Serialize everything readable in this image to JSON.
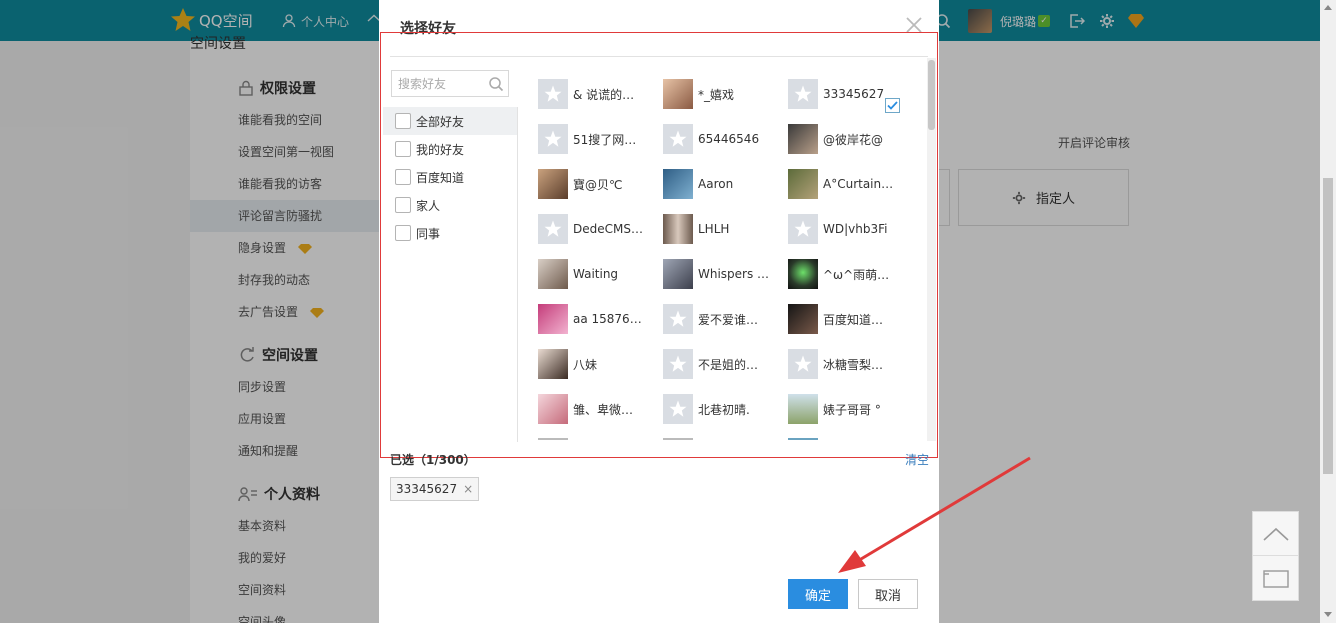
{
  "topbar": {
    "logo": "QQ空间",
    "nav_personal": "个人中心",
    "user_name": "倪璐璐"
  },
  "page": {
    "title": "空间设置",
    "group_permissions": "权限设置",
    "perm_items": [
      "谁能看我的空间",
      "设置空间第一视图",
      "谁能看我的访客",
      "评论留言防骚扰",
      "隐身设置",
      "封存我的动态",
      "去广告设置"
    ],
    "group_space": "空间设置",
    "space_items": [
      "同步设置",
      "应用设置",
      "通知和提醒"
    ],
    "group_profile": "个人资料",
    "profile_items": [
      "基本资料",
      "我的爱好",
      "空间资料",
      "空间头像"
    ],
    "right_link": "开启评论审核",
    "specified_label": "指定人"
  },
  "dialog": {
    "title": "选择好友",
    "search_placeholder": "搜索好友",
    "groups": [
      "全部好友",
      "我的好友",
      "百度知道",
      "家人",
      "同事"
    ],
    "friends": [
      "& 说谎的…",
      "*_嬉戏",
      "33345627",
      "51搜了网…",
      "65446546",
      "@彼岸花@",
      "寶@贝℃",
      "Aaron",
      "A°Curtain…",
      "DedeCMS…",
      "LHLH",
      "WD|vhb3Fi",
      "Waiting",
      "Whispers …",
      "^ω^雨萌…",
      "aa 15876…",
      "爱不爱谁…",
      "百度知道…",
      "八妹",
      "不是姐的…",
      "冰糖雪梨…",
      "雏、卑微…",
      "北巷初晴.",
      "婊子哥哥 °"
    ],
    "selected_count": "已选（1/300）",
    "clear_label": "清空",
    "selected_tags": [
      "33345627"
    ],
    "ok_label": "确定",
    "cancel_label": "取消"
  },
  "colors": {
    "topbar": "#0f8da0",
    "primary_button": "#2a8de0",
    "annotation_red": "#e03a3a"
  }
}
